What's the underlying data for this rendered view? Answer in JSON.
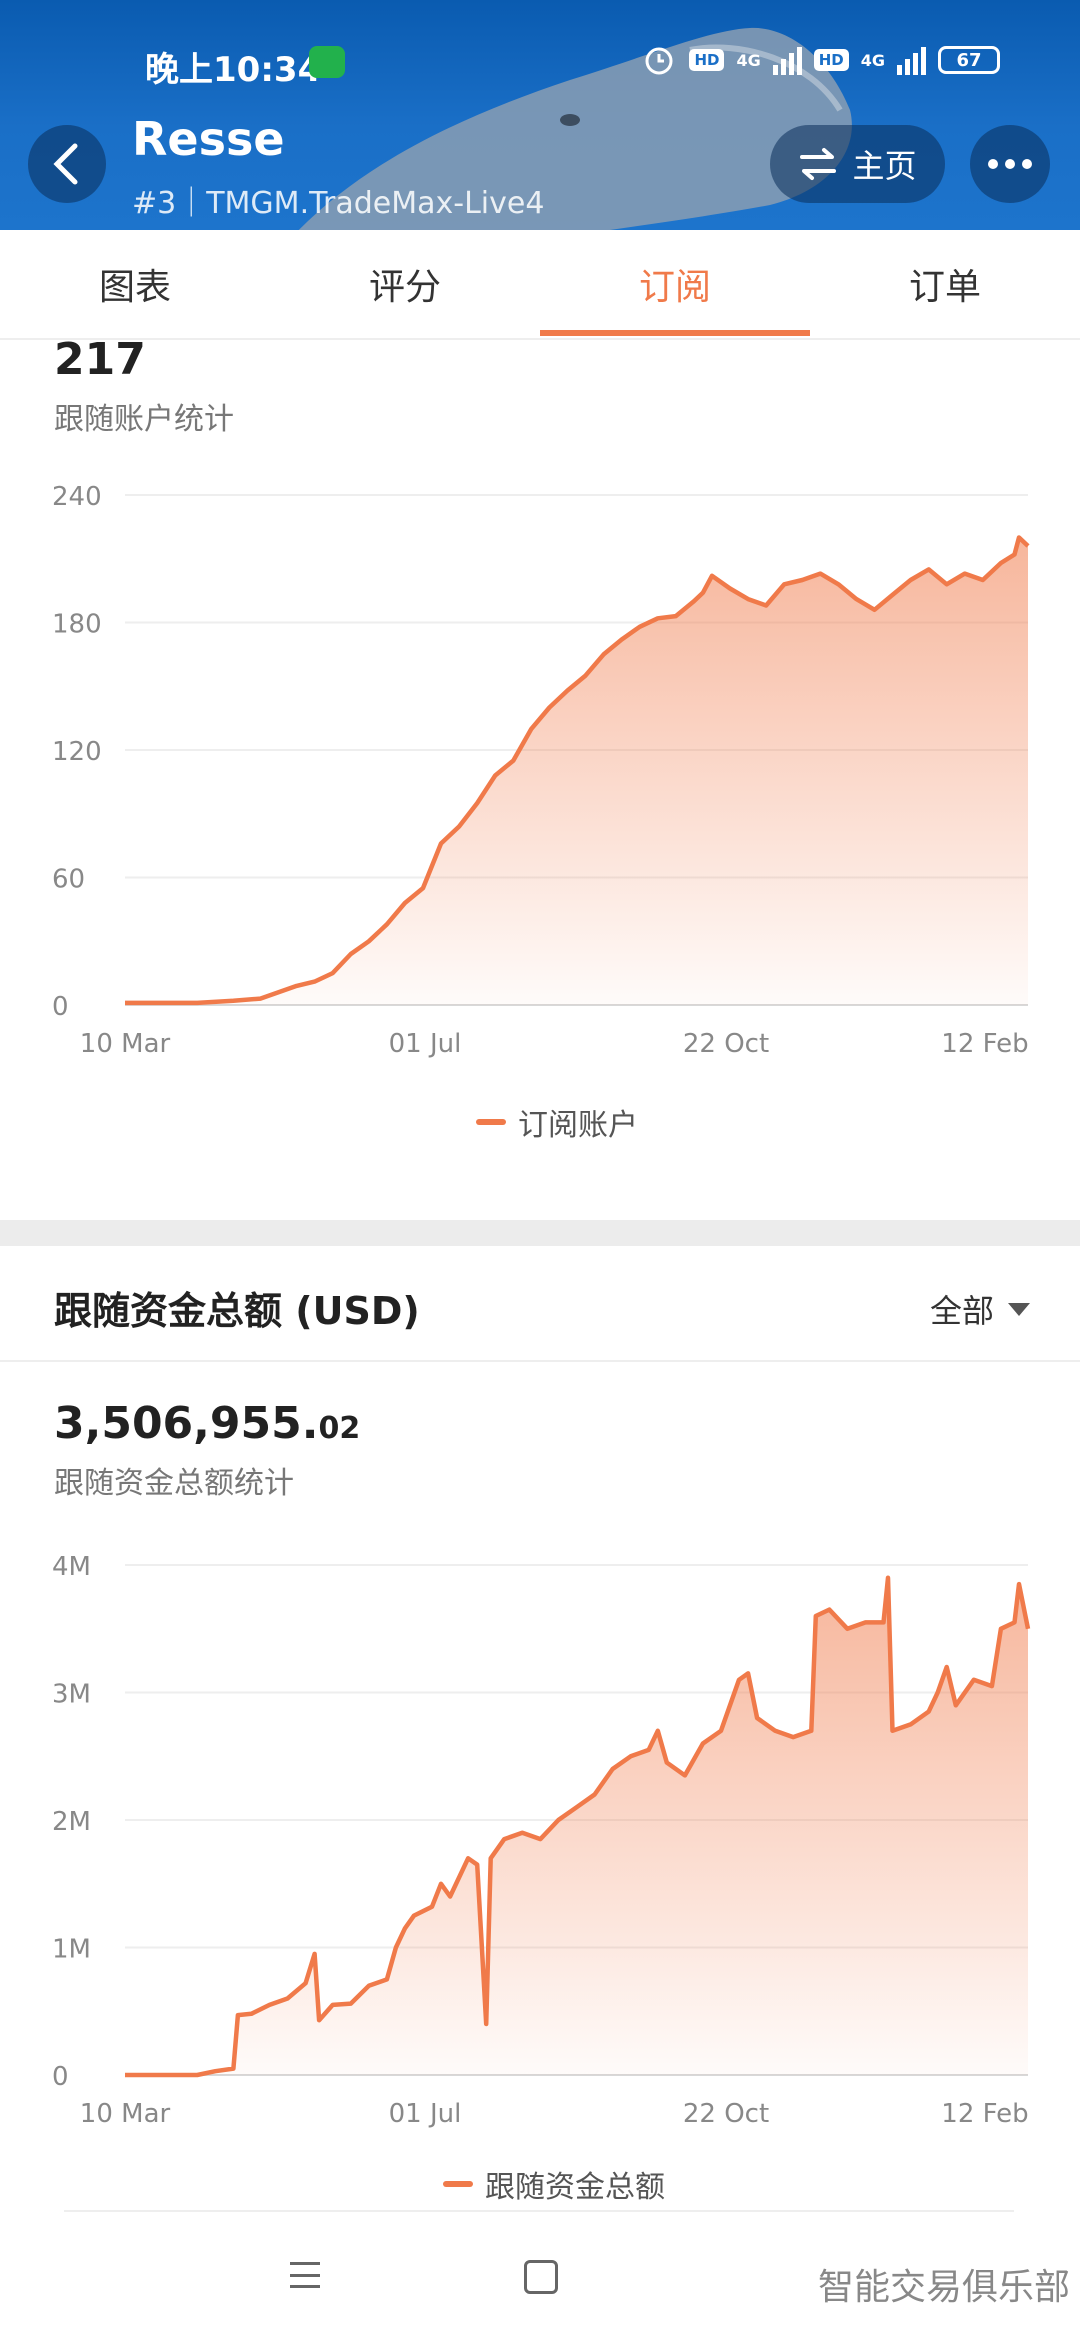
{
  "status_bar": {
    "time": "晚上10:34",
    "net_a": "4G",
    "net_b": "4G",
    "hd": "HD",
    "battery": "67"
  },
  "header": {
    "title": "Resse",
    "subtitle": "#3｜TMGM.TradeMax-Live4",
    "home_label": "主页"
  },
  "tabs": [
    {
      "label": "图表"
    },
    {
      "label": "评分"
    },
    {
      "label": "订阅",
      "active": true
    },
    {
      "label": "订单"
    }
  ],
  "followers": {
    "value": "217",
    "caption": "跟随账户统计",
    "legend": "订阅账户"
  },
  "funds": {
    "section_title": "跟随资金总额 (USD)",
    "filter_label": "全部",
    "value_int": "3,506,955.",
    "value_dec": "02",
    "caption": "跟随资金总额统计",
    "legend": "跟随资金总额"
  },
  "watermark": "智能交易俱乐部",
  "colors": {
    "accent": "#f07a4a",
    "header_blue": "#1a6fc7"
  },
  "chart_data": [
    {
      "type": "area",
      "x_ticks": [
        "10 Mar",
        "01 Jul",
        "22 Oct",
        "12 Feb"
      ],
      "y_ticks": [
        "0",
        "60",
        "120",
        "180",
        "240"
      ],
      "ylim": [
        0,
        240
      ],
      "series": [
        {
          "name": "订阅账户",
          "points": [
            [
              0,
              1
            ],
            [
              0.05,
              1
            ],
            [
              0.08,
              1
            ],
            [
              0.12,
              2
            ],
            [
              0.15,
              3
            ],
            [
              0.17,
              6
            ],
            [
              0.19,
              9
            ],
            [
              0.21,
              11
            ],
            [
              0.23,
              15
            ],
            [
              0.25,
              24
            ],
            [
              0.27,
              30
            ],
            [
              0.29,
              38
            ],
            [
              0.31,
              48
            ],
            [
              0.33,
              55
            ],
            [
              0.35,
              76
            ],
            [
              0.37,
              84
            ],
            [
              0.39,
              95
            ],
            [
              0.41,
              108
            ],
            [
              0.43,
              115
            ],
            [
              0.45,
              130
            ],
            [
              0.47,
              140
            ],
            [
              0.49,
              148
            ],
            [
              0.51,
              155
            ],
            [
              0.53,
              165
            ],
            [
              0.55,
              172
            ],
            [
              0.57,
              178
            ],
            [
              0.59,
              182
            ],
            [
              0.61,
              183
            ],
            [
              0.63,
              190
            ],
            [
              0.64,
              194
            ],
            [
              0.65,
              202
            ],
            [
              0.67,
              196
            ],
            [
              0.69,
              191
            ],
            [
              0.71,
              188
            ],
            [
              0.73,
              198
            ],
            [
              0.75,
              200
            ],
            [
              0.77,
              203
            ],
            [
              0.79,
              198
            ],
            [
              0.81,
              191
            ],
            [
              0.83,
              186
            ],
            [
              0.85,
              193
            ],
            [
              0.87,
              200
            ],
            [
              0.89,
              205
            ],
            [
              0.91,
              198
            ],
            [
              0.93,
              203
            ],
            [
              0.95,
              200
            ],
            [
              0.97,
              208
            ],
            [
              0.985,
              212
            ],
            [
              0.99,
              220
            ],
            [
              1.0,
              216
            ]
          ]
        }
      ]
    },
    {
      "type": "area",
      "x_ticks": [
        "10 Mar",
        "01 Jul",
        "22 Oct",
        "12 Feb"
      ],
      "y_ticks": [
        "0",
        "1M",
        "2M",
        "3M",
        "4M"
      ],
      "ylim": [
        0,
        4000000
      ],
      "series": [
        {
          "name": "跟随资金总额",
          "points": [
            [
              0,
              0
            ],
            [
              0.05,
              0
            ],
            [
              0.08,
              0
            ],
            [
              0.1,
              30000
            ],
            [
              0.12,
              50000
            ],
            [
              0.125,
              470000
            ],
            [
              0.14,
              480000
            ],
            [
              0.16,
              550000
            ],
            [
              0.18,
              600000
            ],
            [
              0.2,
              720000
            ],
            [
              0.21,
              950000
            ],
            [
              0.215,
              430000
            ],
            [
              0.23,
              550000
            ],
            [
              0.25,
              560000
            ],
            [
              0.27,
              700000
            ],
            [
              0.29,
              750000
            ],
            [
              0.3,
              1000000
            ],
            [
              0.31,
              1150000
            ],
            [
              0.32,
              1250000
            ],
            [
              0.34,
              1320000
            ],
            [
              0.35,
              1500000
            ],
            [
              0.36,
              1400000
            ],
            [
              0.38,
              1700000
            ],
            [
              0.39,
              1650000
            ],
            [
              0.4,
              400000
            ],
            [
              0.405,
              1700000
            ],
            [
              0.42,
              1850000
            ],
            [
              0.44,
              1900000
            ],
            [
              0.46,
              1850000
            ],
            [
              0.48,
              2000000
            ],
            [
              0.5,
              2100000
            ],
            [
              0.52,
              2200000
            ],
            [
              0.54,
              2400000
            ],
            [
              0.56,
              2500000
            ],
            [
              0.58,
              2550000
            ],
            [
              0.59,
              2700000
            ],
            [
              0.6,
              2450000
            ],
            [
              0.62,
              2350000
            ],
            [
              0.64,
              2600000
            ],
            [
              0.66,
              2700000
            ],
            [
              0.68,
              3100000
            ],
            [
              0.69,
              3150000
            ],
            [
              0.7,
              2800000
            ],
            [
              0.72,
              2700000
            ],
            [
              0.74,
              2650000
            ],
            [
              0.76,
              2700000
            ],
            [
              0.765,
              3600000
            ],
            [
              0.78,
              3650000
            ],
            [
              0.8,
              3500000
            ],
            [
              0.82,
              3550000
            ],
            [
              0.84,
              3550000
            ],
            [
              0.845,
              3900000
            ],
            [
              0.85,
              2700000
            ],
            [
              0.87,
              2750000
            ],
            [
              0.89,
              2850000
            ],
            [
              0.9,
              3000000
            ],
            [
              0.91,
              3200000
            ],
            [
              0.92,
              2900000
            ],
            [
              0.94,
              3100000
            ],
            [
              0.96,
              3050000
            ],
            [
              0.97,
              3500000
            ],
            [
              0.985,
              3550000
            ],
            [
              0.99,
              3850000
            ],
            [
              1.0,
              3500000
            ]
          ]
        }
      ]
    }
  ]
}
